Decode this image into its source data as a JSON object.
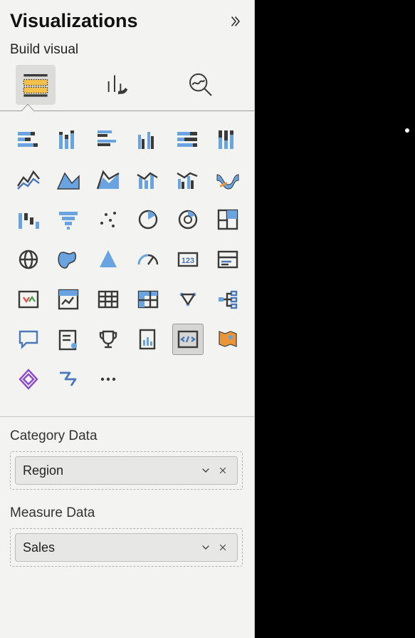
{
  "header": {
    "title": "Visualizations"
  },
  "subtitle": "Build visual",
  "tabs": [
    {
      "name": "build-visual-tab",
      "selected": true
    },
    {
      "name": "format-visual-tab",
      "selected": false
    },
    {
      "name": "analytics-tab",
      "selected": false
    }
  ],
  "viz_icons": [
    "stacked-bar-chart",
    "stacked-column-chart",
    "clustered-bar-chart",
    "clustered-column-chart",
    "hundred-stacked-bar-chart",
    "hundred-stacked-column-chart",
    "line-chart",
    "area-chart",
    "stacked-area-chart",
    "line-stacked-column-chart",
    "line-clustered-column-chart",
    "ribbon-chart",
    "waterfall-chart",
    "funnel-chart",
    "scatter-chart",
    "pie-chart",
    "donut-chart",
    "treemap-chart",
    "map-chart",
    "filled-map-chart",
    "azure-map-chart",
    "gauge-chart",
    "card-chart",
    "multi-row-card-chart",
    "kpi-chart",
    "slicer-chart",
    "table-chart",
    "matrix-chart",
    "r-visual-chart",
    "decomposition-tree-chart",
    "qna-chart",
    "narrative-chart",
    "goals-chart",
    "paginated-report-chart",
    "script-visual-chart",
    "arcgis-chart",
    "power-apps-chart",
    "power-automate-chart",
    "more-visuals"
  ],
  "selected_viz": "script-visual-chart",
  "fields": {
    "category": {
      "label": "Category Data",
      "items": [
        "Region"
      ]
    },
    "measure": {
      "label": "Measure Data",
      "items": [
        "Sales"
      ]
    }
  }
}
